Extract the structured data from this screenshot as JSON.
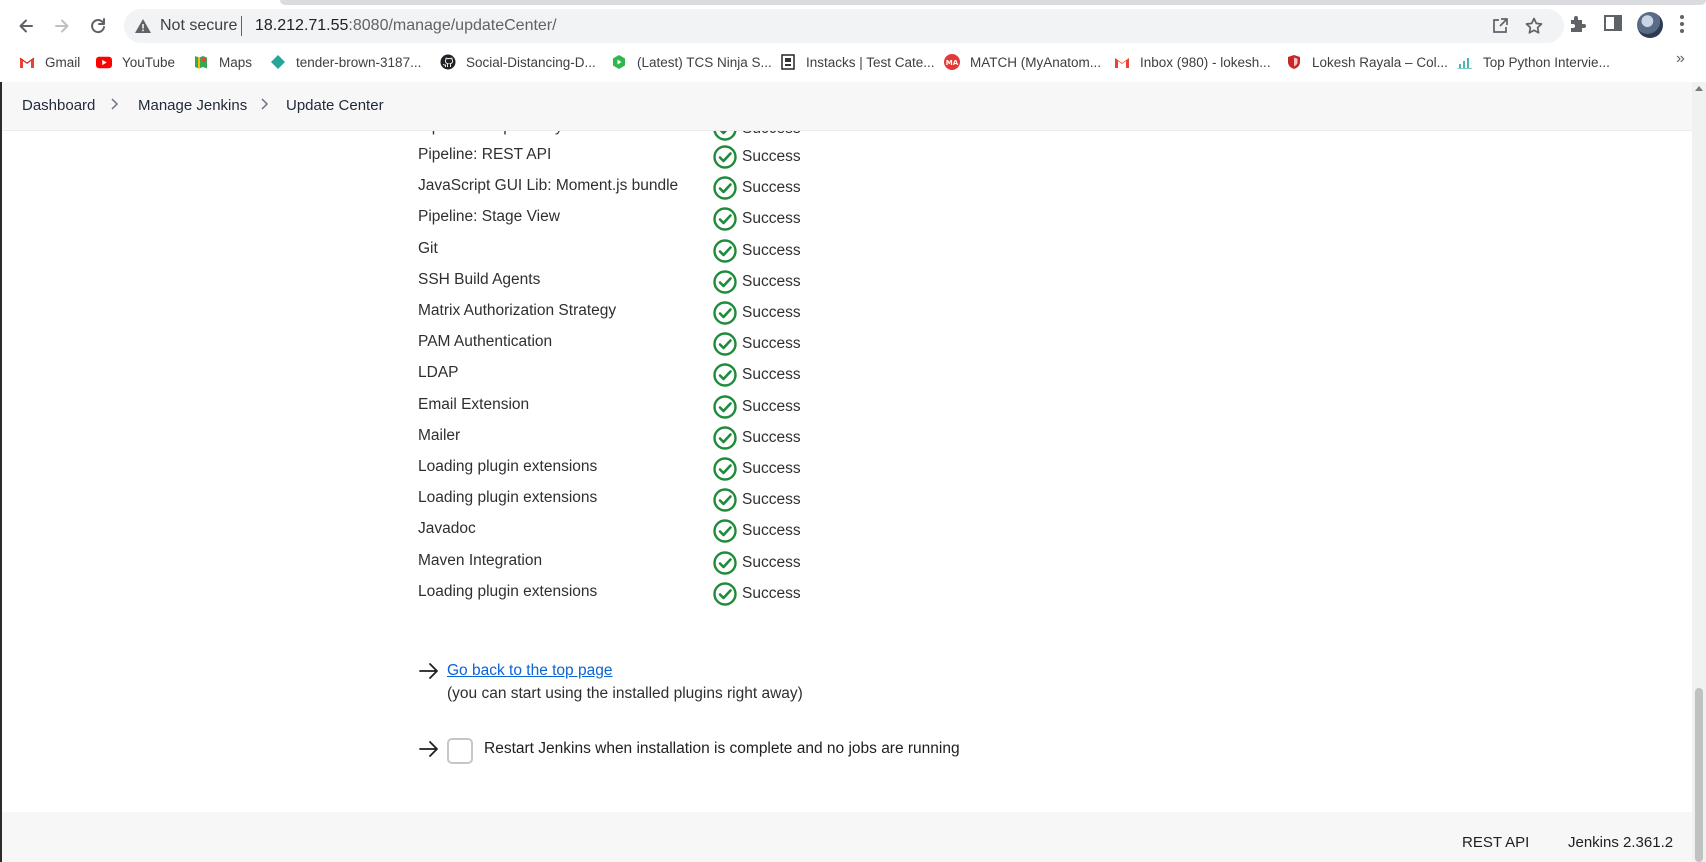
{
  "browser": {
    "security_label": "Not secure",
    "url_host": "18.212.71.55",
    "url_rest": ":8080/manage/updateCenter/",
    "bookmarks": [
      {
        "label": "Gmail",
        "icon": "gmail-icon"
      },
      {
        "label": "YouTube",
        "icon": "youtube-icon"
      },
      {
        "label": "Maps",
        "icon": "maps-icon"
      },
      {
        "label": "tender-brown-3187...",
        "icon": "diamond-icon"
      },
      {
        "label": "Social-Distancing-D...",
        "icon": "github-icon"
      },
      {
        "label": "(Latest) TCS Ninja S...",
        "icon": "hexagon-icon"
      },
      {
        "label": "Instacks | Test Cate...",
        "icon": "instacks-icon"
      },
      {
        "label": "MATCH (MyAnatom...",
        "icon": "ma-icon"
      },
      {
        "label": "Inbox (980) - lokesh...",
        "icon": "gmail-icon"
      },
      {
        "label": "Lokesh Rayala – Col...",
        "icon": "shield-icon"
      },
      {
        "label": "Top Python Intervie...",
        "icon": "chart-icon"
      }
    ],
    "more_bookmarks": "»"
  },
  "breadcrumb": {
    "items": [
      "Dashboard",
      "Manage Jenkins",
      "Update Center"
    ]
  },
  "plugins": {
    "partial_top": {
      "name": "Pipeline Graph Analysis",
      "status": "Success"
    },
    "rows": [
      {
        "name": "Pipeline: REST API",
        "status": "Success"
      },
      {
        "name": "JavaScript GUI Lib: Moment.js bundle",
        "status": "Success"
      },
      {
        "name": "Pipeline: Stage View",
        "status": "Success"
      },
      {
        "name": "Git",
        "status": "Success"
      },
      {
        "name": "SSH Build Agents",
        "status": "Success"
      },
      {
        "name": "Matrix Authorization Strategy",
        "status": "Success"
      },
      {
        "name": "PAM Authentication",
        "status": "Success"
      },
      {
        "name": "LDAP",
        "status": "Success"
      },
      {
        "name": "Email Extension",
        "status": "Success"
      },
      {
        "name": "Mailer",
        "status": "Success"
      },
      {
        "name": "Loading plugin extensions",
        "status": "Success"
      },
      {
        "name": "Loading plugin extensions",
        "status": "Success"
      },
      {
        "name": "Javadoc",
        "status": "Success"
      },
      {
        "name": "Maven Integration",
        "status": "Success"
      },
      {
        "name": "Loading plugin extensions",
        "status": "Success"
      }
    ]
  },
  "actions": {
    "back_link": "Go back to the top page",
    "back_note": "(you can start using the installed plugins right away)",
    "restart_label": "Restart Jenkins when installation is complete and no jobs are running",
    "restart_checked": false
  },
  "footer": {
    "rest_api": "REST API",
    "version": "Jenkins 2.361.2"
  },
  "colors": {
    "success_green": "#1e8b3a",
    "link_blue": "#0b63d6"
  }
}
